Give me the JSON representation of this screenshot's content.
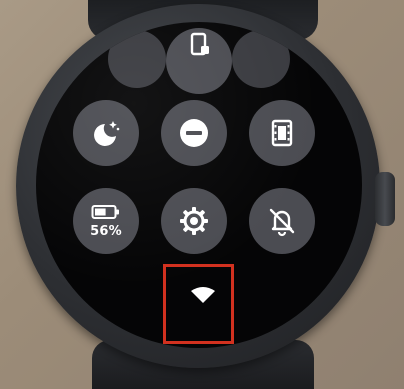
{
  "tiles": [
    {
      "name": "tile-partial-left",
      "icon": "unknown-icon"
    },
    {
      "name": "tile-phone-connection",
      "icon": "phone-icon"
    },
    {
      "name": "tile-partial-right",
      "icon": "unknown-icon"
    },
    {
      "name": "tile-bedtime-mode",
      "icon": "moon-stars-icon"
    },
    {
      "name": "tile-do-not-disturb",
      "icon": "minus-circle-icon"
    },
    {
      "name": "tile-theater-mode",
      "icon": "film-icon"
    },
    {
      "name": "tile-battery",
      "icon": "battery-icon",
      "battery_level": 0.56
    },
    {
      "name": "tile-settings",
      "icon": "gear-icon"
    },
    {
      "name": "tile-sound-off",
      "icon": "bell-off-icon"
    }
  ],
  "battery": {
    "label": "56%"
  },
  "network": {
    "icon": "wifi-icon"
  },
  "colors": {
    "tile_background": "#4b4c52",
    "icon": "#ffffff",
    "highlight_box": "#d2311f",
    "screen": "#050506"
  }
}
